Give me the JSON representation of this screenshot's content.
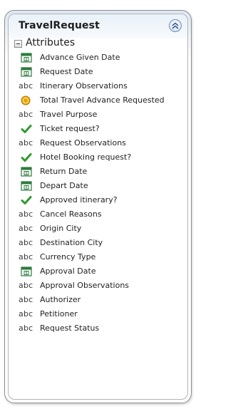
{
  "entity": {
    "title": "TravelRequest",
    "section": "Attributes",
    "attributes": [
      {
        "label": "Advance Given Date",
        "type": "date"
      },
      {
        "label": "Request Date",
        "type": "date"
      },
      {
        "label": "Itinerary Observations",
        "type": "text"
      },
      {
        "label": "Total Travel Advance Requested",
        "type": "money"
      },
      {
        "label": "Travel Purpose",
        "type": "text"
      },
      {
        "label": "Ticket request?",
        "type": "boolean"
      },
      {
        "label": "Request Observations",
        "type": "text"
      },
      {
        "label": "Hotel Booking request?",
        "type": "boolean"
      },
      {
        "label": "Return Date",
        "type": "date"
      },
      {
        "label": "Depart Date",
        "type": "date"
      },
      {
        "label": "Approved itinerary?",
        "type": "boolean"
      },
      {
        "label": "Cancel Reasons",
        "type": "text"
      },
      {
        "label": "Origin City",
        "type": "text"
      },
      {
        "label": "Destination City",
        "type": "text"
      },
      {
        "label": "Currency Type",
        "type": "text"
      },
      {
        "label": "Approval Date",
        "type": "date"
      },
      {
        "label": "Approval Observations",
        "type": "text"
      },
      {
        "label": "Authorizer",
        "type": "text"
      },
      {
        "label": "Petitioner",
        "type": "text"
      },
      {
        "label": "Request Status",
        "type": "text"
      }
    ]
  },
  "icons": {
    "text": {
      "name": "text-type-icon",
      "glyph": "abc"
    },
    "date": {
      "name": "calendar-icon"
    },
    "boolean": {
      "name": "checkmark-icon"
    },
    "money": {
      "name": "coin-icon"
    },
    "collapse": {
      "name": "collapse-chevron-icon"
    }
  },
  "colors": {
    "check": "#2f9a2f",
    "coin": "#e8a400",
    "calendar": "#2d7a3e",
    "border": "#8e8e8e",
    "accent": "#6f8fb8"
  }
}
